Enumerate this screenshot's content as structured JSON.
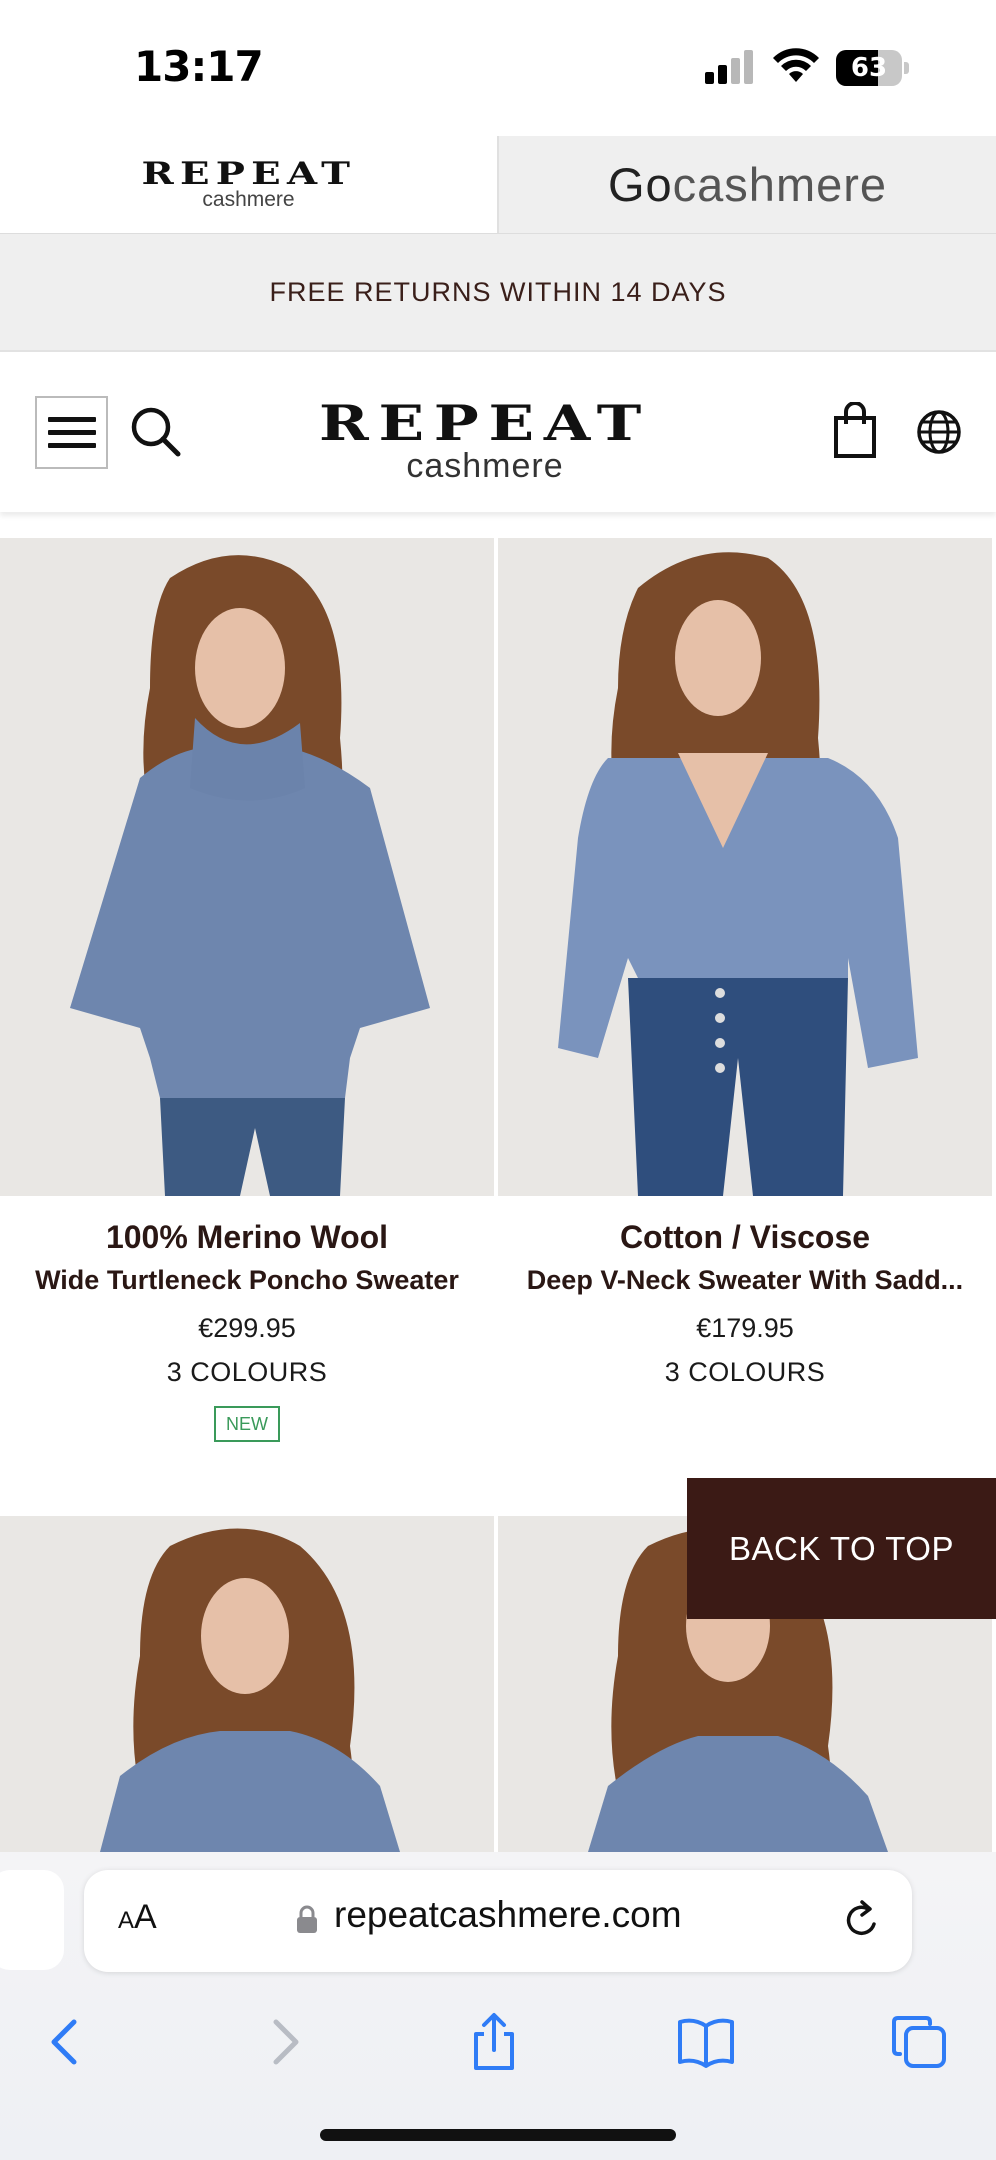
{
  "status_bar": {
    "time": "13:17",
    "battery": "63",
    "battery_level": 0.63
  },
  "brand_tabs": {
    "active": {
      "logo_main": "REPEAT",
      "logo_sub": "cashmere"
    },
    "inactive": {
      "logo_go": "Go",
      "logo_rest": "cashmere"
    }
  },
  "announcement": "FREE RETURNS WITHIN 14 DAYS",
  "header": {
    "logo_main": "REPEAT",
    "logo_sub": "cashmere"
  },
  "products": [
    {
      "material": "100% Merino Wool",
      "name": "Wide Turtleneck Poncho Sweater",
      "price": "€299.95",
      "colours": "3 COLOURS",
      "badge": "NEW"
    },
    {
      "material": "Cotton / Viscose",
      "name": "Deep V-Neck Sweater With Sadd...",
      "price": "€179.95",
      "colours": "3 COLOURS",
      "badge": ""
    }
  ],
  "back_to_top": "BACK TO TOP",
  "browser": {
    "aa_label_small": "A",
    "aa_label_large": "A",
    "url": "repeatcashmere.com"
  },
  "colors": {
    "brand_dark": "#3b1a15",
    "badge_green": "#3a9a5a",
    "safari_blue": "#2f7cf6",
    "sweater_blue": "#6e86ae",
    "denim": "#3d5a82"
  },
  "icons": [
    "menu-icon",
    "search-icon",
    "bag-icon",
    "globe-icon",
    "lock-icon",
    "reload-icon",
    "back-icon",
    "forward-icon",
    "share-icon",
    "bookmarks-icon",
    "tabs-icon"
  ]
}
